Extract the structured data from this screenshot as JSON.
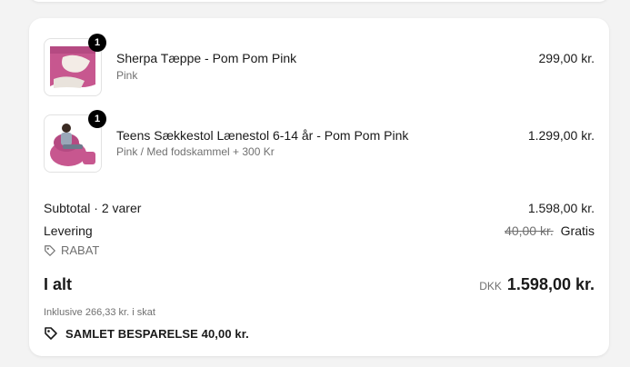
{
  "items": [
    {
      "quantity": "1",
      "name": "Sherpa Tæppe - Pom Pom Pink",
      "variant": "Pink",
      "price": "299,00 kr."
    },
    {
      "quantity": "1",
      "name": "Teens Sækkestol Lænestol 6-14 år - Pom Pom Pink",
      "variant": "Pink / Med fodskammel + 300 Kr",
      "price": "1.299,00 kr."
    }
  ],
  "summary": {
    "subtotal_label": "Subtotal · 2 varer",
    "subtotal_value": "1.598,00 kr.",
    "shipping_label": "Levering",
    "shipping_original": "40,00 kr.",
    "shipping_value": "Gratis",
    "discount_label": "RABAT",
    "total_label": "I alt",
    "total_currency": "DKK",
    "total_value": "1.598,00 kr.",
    "tax_text": "Inklusive 266,33 kr. i skat",
    "savings_text": "SAMLET BESPARELSE 40,00 kr."
  },
  "colors": {
    "product_pink": "#c7578f",
    "background": "#f3f3f3"
  },
  "icons": {
    "discount": "tag-icon",
    "savings": "tag-icon"
  }
}
